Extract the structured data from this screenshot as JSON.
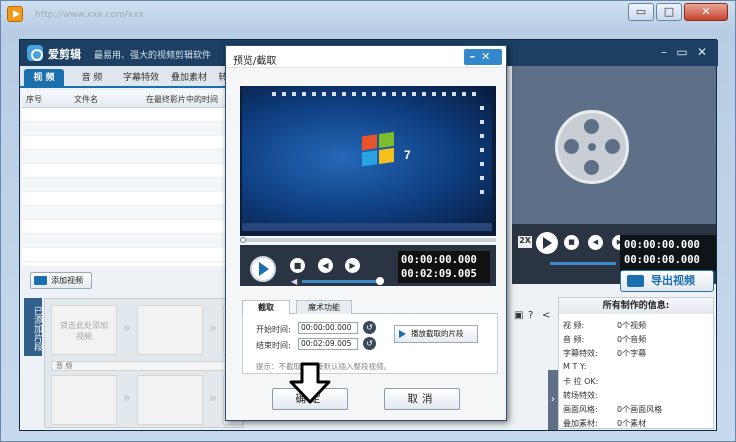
{
  "window": {
    "url_text": "http://www.xxx.com/xxx",
    "min": "▭",
    "max": "□",
    "close": "✕"
  },
  "app": {
    "name": "爱剪辑",
    "slogan": "最易用、强大的视频剪辑软件"
  },
  "tabs": [
    {
      "label": "视  频"
    },
    {
      "label": "音  频"
    },
    {
      "label": "字幕特效"
    },
    {
      "label": "叠加素材"
    },
    {
      "label": "转场特效"
    }
  ],
  "table": {
    "headers": [
      "序号",
      "文件名",
      "在最终影片中的时间"
    ]
  },
  "add_video": {
    "label": "添加视频"
  },
  "sidebar": {
    "label": "已添加片段"
  },
  "timeline": {
    "slot_text": "双击此处添加视频",
    "audio_label": "音 频"
  },
  "preview": {
    "time_start": "00:00:00.000",
    "time_end": "00:00:00.000",
    "speed": "2X"
  },
  "export": {
    "label": "导出视频"
  },
  "info": {
    "title": "所有制作的信息:",
    "rows": [
      {
        "k": "视    频:",
        "v": "0个视频"
      },
      {
        "k": "音    频:",
        "v": "0个音频"
      },
      {
        "k": "字幕特效:",
        "v": "0个字幕"
      },
      {
        "k": "M    T    Y:",
        "v": ""
      },
      {
        "k": "卡  拉  OK:",
        "v": ""
      },
      {
        "k": "转场特效:",
        "v": ""
      },
      {
        "k": "画面风格:",
        "v": "0个画面风格"
      },
      {
        "k": "叠加素材:",
        "v": "0个素材"
      }
    ]
  },
  "dialog": {
    "title": "预览/截取",
    "minclose": "–✕",
    "time_current": "00:00:00.000",
    "time_total": "00:02:09.005",
    "cut_tabs": [
      "截取",
      "魔术功能"
    ],
    "start_label": "开始时间:",
    "start_value": "00:00:00.000",
    "end_label": "结束时间:",
    "end_value": "00:02:09.005",
    "play_cut": "播放截取的片段",
    "tip": "提示：不截取可直接默认插入整段视频。",
    "ok": "确定",
    "cancel": "取消"
  },
  "colors": {
    "accent": "#1a6fae",
    "titlebar": "#1c3f62"
  }
}
